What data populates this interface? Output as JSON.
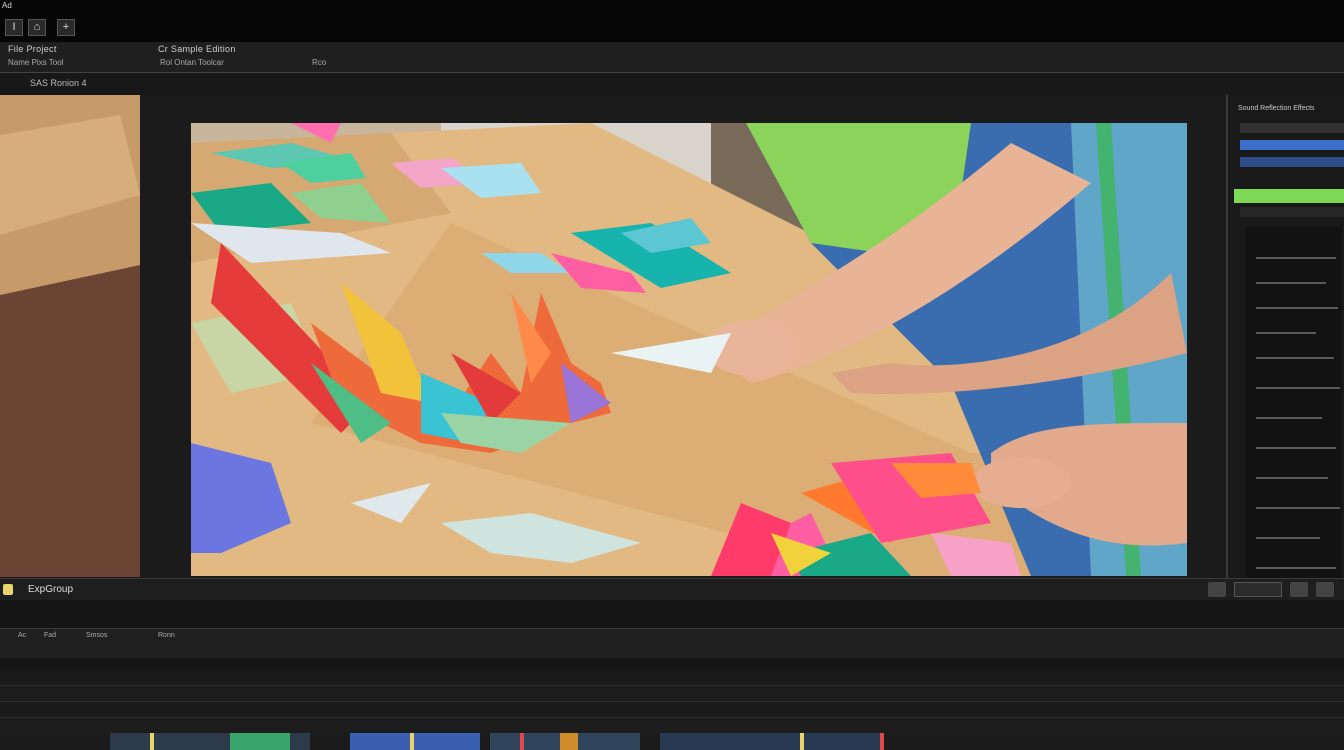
{
  "window": {
    "title_text": "Ad"
  },
  "toolbar": {
    "buttons": [
      "I",
      "⌂",
      "+"
    ]
  },
  "menu": {
    "item1": "File  Project",
    "item2": "Cr Sample Edition"
  },
  "submenu": {
    "text1": "Name  Pixs   Tool",
    "text2": "Rol Ontan Toolcar",
    "text3": "Rco"
  },
  "tabs": {
    "tab1": "SAS Ronion 4"
  },
  "panel": {
    "header": "Sound Reflection Effects"
  },
  "status": {
    "label": "ExpGroup"
  },
  "timeline": {
    "header1": "Ac",
    "header2": "Fad",
    "header3": "Smsos",
    "header4": "Ronn"
  },
  "colors": {
    "accent_blue": "#3b6fc9",
    "accent_green": "#7ed957",
    "swatch_yellow": "#e8d46a"
  }
}
